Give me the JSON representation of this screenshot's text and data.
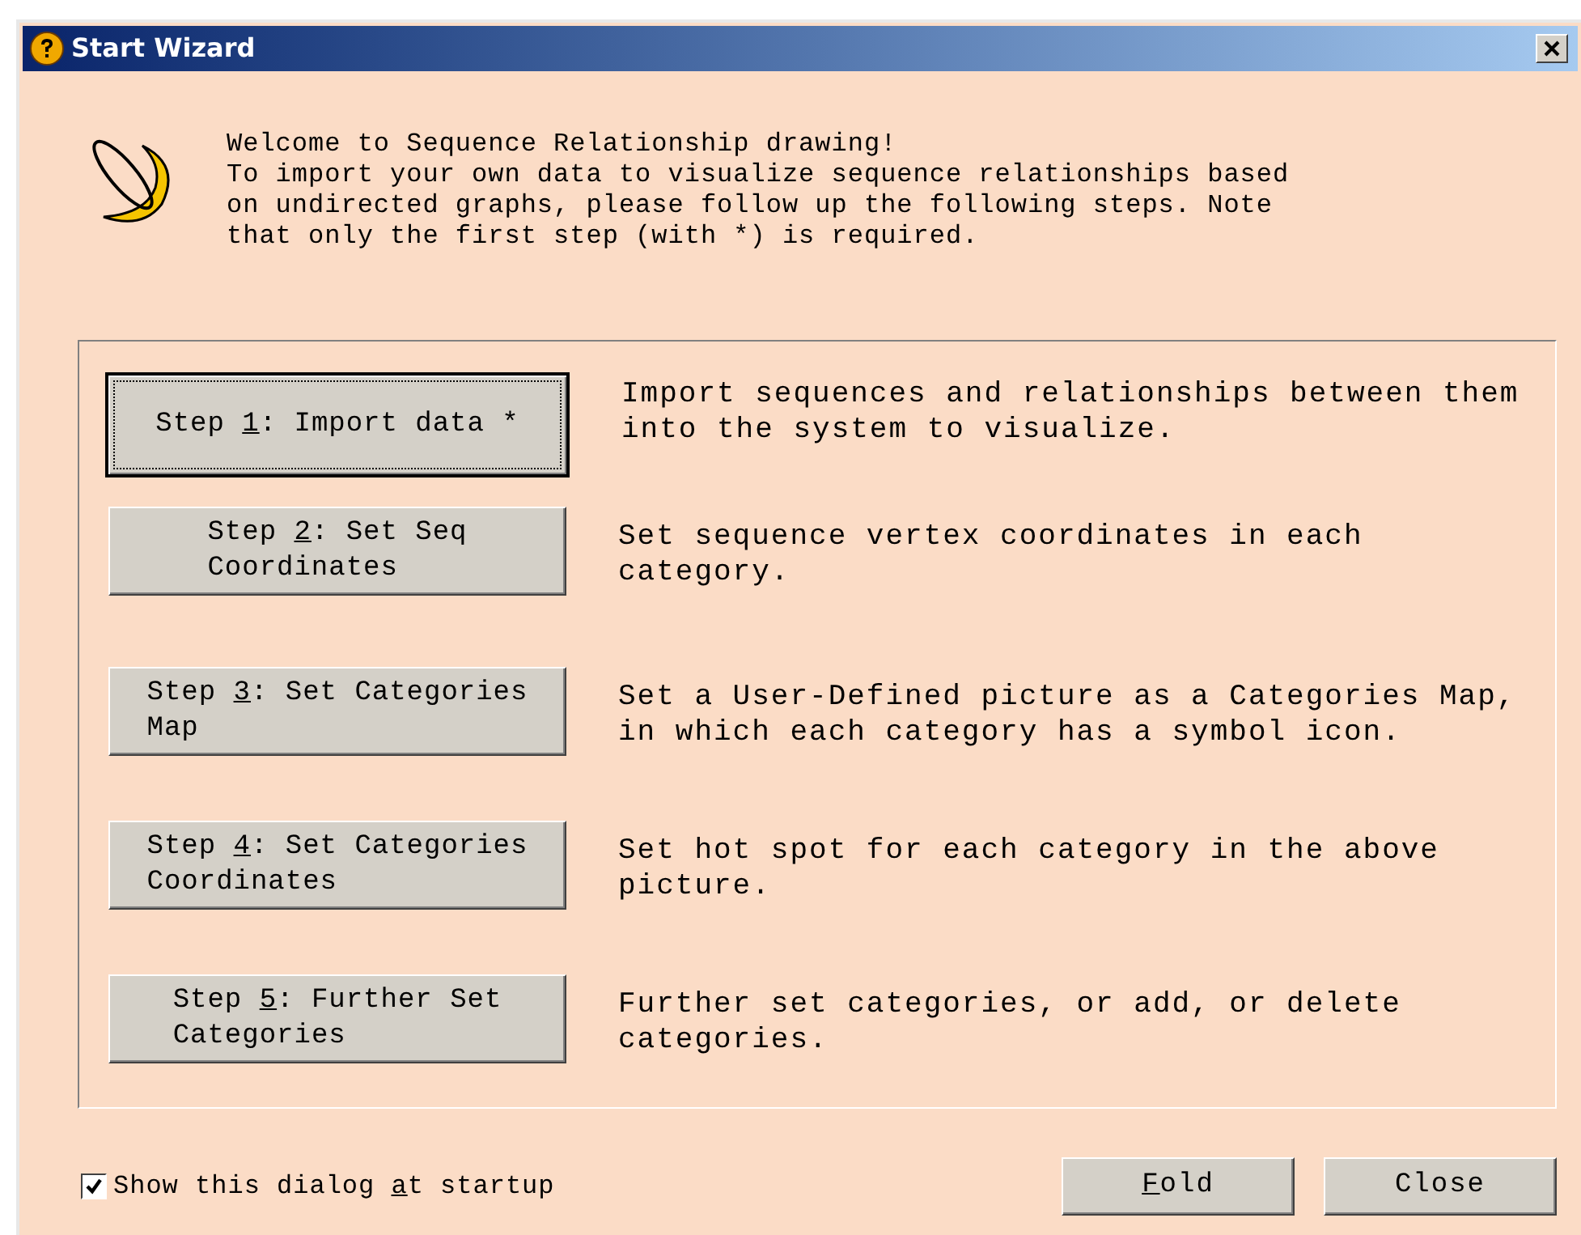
{
  "window": {
    "title": "Start Wizard"
  },
  "welcome": {
    "title": "Welcome to Sequence Relationship drawing!",
    "body": "To import your own data to visualize sequence relationships based on undirected graphs, please follow up the following steps. Note that only the first step (with *) is required."
  },
  "steps": [
    {
      "label": {
        "before": "Step ",
        "access_key": "1",
        "after": ": Import data *"
      },
      "default": true,
      "description": "Import sequences and relationships between them into the system to visualize."
    },
    {
      "label": {
        "before": "Step ",
        "access_key": "2",
        "after": ": Set Seq\nCoordinates"
      },
      "default": false,
      "description": "Set sequence vertex coordinates in each category."
    },
    {
      "label": {
        "before": "Step ",
        "access_key": "3",
        "after": ": Set Categories\nMap"
      },
      "default": false,
      "description": "Set a User-Defined picture as a Categories Map, in which each category has a symbol icon."
    },
    {
      "label": {
        "before": "Step ",
        "access_key": "4",
        "after": ": Set Categories\nCoordinates"
      },
      "default": false,
      "description": "Set hot spot for each category in the above picture."
    },
    {
      "label": {
        "before": "Step ",
        "access_key": "5",
        "after": ": Further Set\nCategories"
      },
      "default": false,
      "description": "Further set categories, or add, or delete categories."
    }
  ],
  "startup_checkbox": {
    "label": {
      "before": "Show this dialog ",
      "access_key": "a",
      "after": "t startup"
    },
    "checked": true
  },
  "buttons": [
    {
      "label": {
        "access_key": "F",
        "after": "old"
      }
    },
    {
      "label": {
        "before": "Close"
      }
    }
  ]
}
